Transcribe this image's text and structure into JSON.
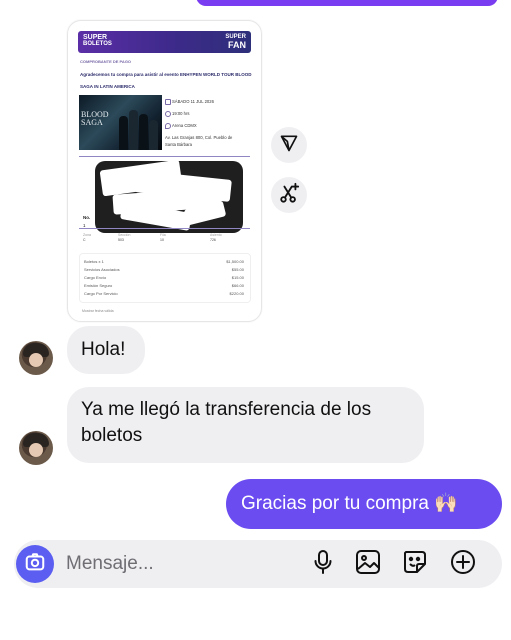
{
  "ticket": {
    "brand_left_1": "SUPER",
    "brand_left_2": "BOLETOS",
    "brand_right_1": "SUPER",
    "brand_right_2": "FAN",
    "receipt_label": "COMPROBANTE DE PAGO",
    "thanks_text": "Agradecemos tu compra para asistir al evento ENHYPEN WORLD TOUR BLOOD SAGA IN LATIN AMERICA",
    "poster_text_1": "BLOOD",
    "poster_text_2": "SAGA",
    "date": "SÁBADO 11 JUL 2026",
    "time": "19:00 hrs",
    "venue": "Arena CDMX",
    "address_1": "Av. Las Granjas 800, Col. Pueblo de",
    "address_2": "Santa Bárbara",
    "col_labels": [
      "Zona",
      "Sección",
      "Fila",
      "Asiento"
    ],
    "col_values": [
      "C",
      "503",
      "10",
      "726"
    ],
    "prices": [
      {
        "label": "Boletos x 1",
        "value": "$1,500.00"
      },
      {
        "label": "Servicios Asociados",
        "value": "$55.00"
      },
      {
        "label": "Cargo Envío",
        "value": "$15.00"
      },
      {
        "label": "Emisión Seguro",
        "value": "$66.00"
      },
      {
        "label": "Cargo Por Servicio",
        "value": "$220.00"
      }
    ],
    "footer_note": "Mostrar fecha válida"
  },
  "messages": {
    "incoming_1": "Hola!",
    "incoming_2": "Ya me llegó la transferencia de los boletos",
    "outgoing_1": "Gracias por tu compra 🙌🏻"
  },
  "composer": {
    "placeholder": "Mensaje..."
  },
  "icons": {
    "share": "send-triangle-icon",
    "remix": "scissors-sparkle-icon",
    "camera": "camera-icon",
    "mic": "microphone-icon",
    "gallery": "image-icon",
    "sticker": "sticker-icon",
    "add": "plus-circle-icon"
  },
  "colors": {
    "outgoing_bubble": "#6b4cf0",
    "incoming_bubble": "#efeff2",
    "camera_button": "#5b5ef0"
  }
}
